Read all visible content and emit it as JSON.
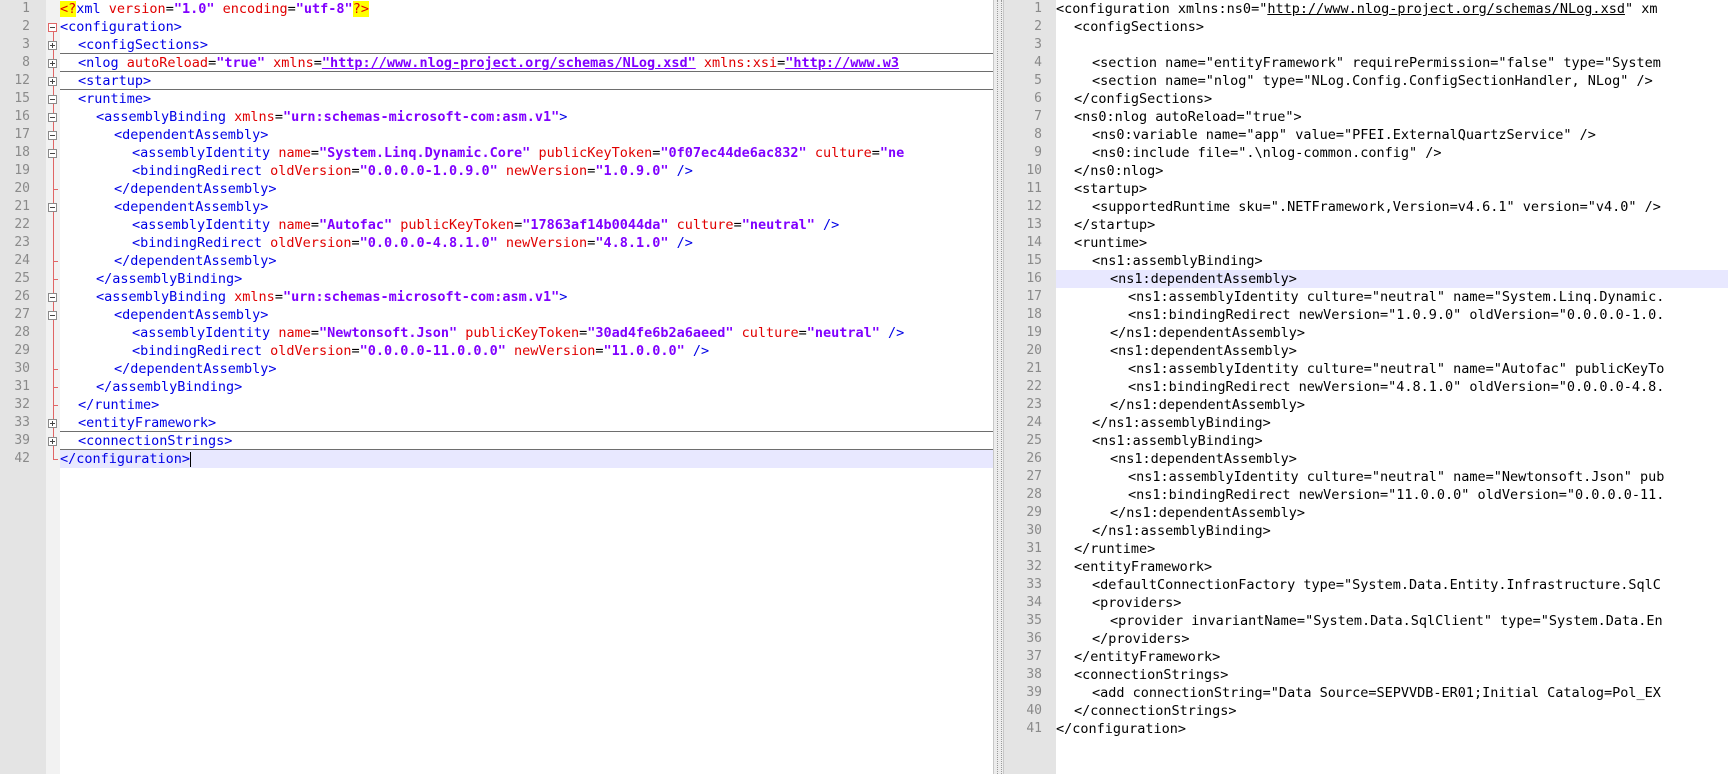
{
  "left_pane": {
    "lines": [
      {
        "num": "1",
        "indent": 0,
        "tokens": [
          {
            "k": "pi",
            "t": "<?"
          },
          {
            "k": "tag",
            "t": "xml "
          },
          {
            "k": "attr",
            "t": "version"
          },
          {
            "k": "plain",
            "t": "="
          },
          {
            "k": "val",
            "t": "\"1.0\""
          },
          {
            "k": "plain",
            "t": " "
          },
          {
            "k": "attr",
            "t": "encoding"
          },
          {
            "k": "plain",
            "t": "="
          },
          {
            "k": "val",
            "t": "\"utf-8\""
          },
          {
            "k": "pi",
            "t": "?>"
          }
        ]
      },
      {
        "num": "2",
        "indent": 0,
        "tokens": [
          {
            "k": "tag",
            "t": "<configuration>"
          }
        ]
      },
      {
        "num": "3",
        "indent": 1,
        "collapsed": true,
        "tokens": [
          {
            "k": "tag",
            "t": "<configSections>"
          }
        ]
      },
      {
        "num": "8",
        "indent": 1,
        "collapsed": true,
        "tokens": [
          {
            "k": "tag",
            "t": "<nlog "
          },
          {
            "k": "attr",
            "t": "autoReload"
          },
          {
            "k": "plain",
            "t": "="
          },
          {
            "k": "val",
            "t": "\"true\""
          },
          {
            "k": "plain",
            "t": " "
          },
          {
            "k": "attr",
            "t": "xmlns"
          },
          {
            "k": "plain",
            "t": "="
          },
          {
            "k": "url",
            "t": "\"http://www.nlog-project.org/schemas/NLog.xsd\""
          },
          {
            "k": "plain",
            "t": " "
          },
          {
            "k": "attr",
            "t": "xmlns:xsi"
          },
          {
            "k": "plain",
            "t": "="
          },
          {
            "k": "url",
            "t": "\"http://www.w3"
          }
        ]
      },
      {
        "num": "12",
        "indent": 1,
        "collapsed": true,
        "tokens": [
          {
            "k": "tag",
            "t": "<startup>"
          }
        ]
      },
      {
        "num": "15",
        "indent": 1,
        "tokens": [
          {
            "k": "tag",
            "t": "<runtime>"
          }
        ]
      },
      {
        "num": "16",
        "indent": 2,
        "tokens": [
          {
            "k": "tag",
            "t": "<assemblyBinding "
          },
          {
            "k": "attr",
            "t": "xmlns"
          },
          {
            "k": "plain",
            "t": "="
          },
          {
            "k": "val",
            "t": "\"urn:schemas-microsoft-com:asm.v1\""
          },
          {
            "k": "tag",
            "t": ">"
          }
        ]
      },
      {
        "num": "17",
        "indent": 3,
        "tokens": [
          {
            "k": "tag",
            "t": "<dependentAssembly>"
          }
        ]
      },
      {
        "num": "18",
        "indent": 4,
        "tokens": [
          {
            "k": "tag",
            "t": "<assemblyIdentity "
          },
          {
            "k": "attr",
            "t": "name"
          },
          {
            "k": "plain",
            "t": "="
          },
          {
            "k": "val",
            "t": "\"System.Linq.Dynamic.Core\""
          },
          {
            "k": "plain",
            "t": " "
          },
          {
            "k": "attr",
            "t": "publicKeyToken"
          },
          {
            "k": "plain",
            "t": "="
          },
          {
            "k": "val",
            "t": "\"0f07ec44de6ac832\""
          },
          {
            "k": "plain",
            "t": " "
          },
          {
            "k": "attr",
            "t": "culture"
          },
          {
            "k": "plain",
            "t": "="
          },
          {
            "k": "val",
            "t": "\"ne"
          }
        ]
      },
      {
        "num": "19",
        "indent": 4,
        "tokens": [
          {
            "k": "tag",
            "t": "<bindingRedirect "
          },
          {
            "k": "attr",
            "t": "oldVersion"
          },
          {
            "k": "plain",
            "t": "="
          },
          {
            "k": "val",
            "t": "\"0.0.0.0-1.0.9.0\""
          },
          {
            "k": "plain",
            "t": " "
          },
          {
            "k": "attr",
            "t": "newVersion"
          },
          {
            "k": "plain",
            "t": "="
          },
          {
            "k": "val",
            "t": "\"1.0.9.0\""
          },
          {
            "k": "plain",
            "t": " "
          },
          {
            "k": "tag",
            "t": "/>"
          }
        ]
      },
      {
        "num": "20",
        "indent": 3,
        "tokens": [
          {
            "k": "tag",
            "t": "</dependentAssembly>"
          }
        ]
      },
      {
        "num": "21",
        "indent": 3,
        "tokens": [
          {
            "k": "tag",
            "t": "<dependentAssembly>"
          }
        ]
      },
      {
        "num": "22",
        "indent": 4,
        "tokens": [
          {
            "k": "tag",
            "t": "<assemblyIdentity "
          },
          {
            "k": "attr",
            "t": "name"
          },
          {
            "k": "plain",
            "t": "="
          },
          {
            "k": "val",
            "t": "\"Autofac\""
          },
          {
            "k": "plain",
            "t": " "
          },
          {
            "k": "attr",
            "t": "publicKeyToken"
          },
          {
            "k": "plain",
            "t": "="
          },
          {
            "k": "val",
            "t": "\"17863af14b0044da\""
          },
          {
            "k": "plain",
            "t": " "
          },
          {
            "k": "attr",
            "t": "culture"
          },
          {
            "k": "plain",
            "t": "="
          },
          {
            "k": "val",
            "t": "\"neutral\""
          },
          {
            "k": "plain",
            "t": " "
          },
          {
            "k": "tag",
            "t": "/>"
          }
        ]
      },
      {
        "num": "23",
        "indent": 4,
        "tokens": [
          {
            "k": "tag",
            "t": "<bindingRedirect "
          },
          {
            "k": "attr",
            "t": "oldVersion"
          },
          {
            "k": "plain",
            "t": "="
          },
          {
            "k": "val",
            "t": "\"0.0.0.0-4.8.1.0\""
          },
          {
            "k": "plain",
            "t": " "
          },
          {
            "k": "attr",
            "t": "newVersion"
          },
          {
            "k": "plain",
            "t": "="
          },
          {
            "k": "val",
            "t": "\"4.8.1.0\""
          },
          {
            "k": "plain",
            "t": " "
          },
          {
            "k": "tag",
            "t": "/>"
          }
        ]
      },
      {
        "num": "24",
        "indent": 3,
        "tokens": [
          {
            "k": "tag",
            "t": "</dependentAssembly>"
          }
        ]
      },
      {
        "num": "25",
        "indent": 2,
        "tokens": [
          {
            "k": "tag",
            "t": "</assemblyBinding>"
          }
        ]
      },
      {
        "num": "26",
        "indent": 2,
        "tokens": [
          {
            "k": "tag",
            "t": "<assemblyBinding "
          },
          {
            "k": "attr",
            "t": "xmlns"
          },
          {
            "k": "plain",
            "t": "="
          },
          {
            "k": "val",
            "t": "\"urn:schemas-microsoft-com:asm.v1\""
          },
          {
            "k": "tag",
            "t": ">"
          }
        ]
      },
      {
        "num": "27",
        "indent": 3,
        "tokens": [
          {
            "k": "tag",
            "t": "<dependentAssembly>"
          }
        ]
      },
      {
        "num": "28",
        "indent": 4,
        "tokens": [
          {
            "k": "tag",
            "t": "<assemblyIdentity "
          },
          {
            "k": "attr",
            "t": "name"
          },
          {
            "k": "plain",
            "t": "="
          },
          {
            "k": "val",
            "t": "\"Newtonsoft.Json\""
          },
          {
            "k": "plain",
            "t": " "
          },
          {
            "k": "attr",
            "t": "publicKeyToken"
          },
          {
            "k": "plain",
            "t": "="
          },
          {
            "k": "val",
            "t": "\"30ad4fe6b2a6aeed\""
          },
          {
            "k": "plain",
            "t": " "
          },
          {
            "k": "attr",
            "t": "culture"
          },
          {
            "k": "plain",
            "t": "="
          },
          {
            "k": "val",
            "t": "\"neutral\""
          },
          {
            "k": "plain",
            "t": " "
          },
          {
            "k": "tag",
            "t": "/>"
          }
        ]
      },
      {
        "num": "29",
        "indent": 4,
        "tokens": [
          {
            "k": "tag",
            "t": "<bindingRedirect "
          },
          {
            "k": "attr",
            "t": "oldVersion"
          },
          {
            "k": "plain",
            "t": "="
          },
          {
            "k": "val",
            "t": "\"0.0.0.0-11.0.0.0\""
          },
          {
            "k": "plain",
            "t": " "
          },
          {
            "k": "attr",
            "t": "newVersion"
          },
          {
            "k": "plain",
            "t": "="
          },
          {
            "k": "val",
            "t": "\"11.0.0.0\""
          },
          {
            "k": "plain",
            "t": " "
          },
          {
            "k": "tag",
            "t": "/>"
          }
        ]
      },
      {
        "num": "30",
        "indent": 3,
        "tokens": [
          {
            "k": "tag",
            "t": "</dependentAssembly>"
          }
        ]
      },
      {
        "num": "31",
        "indent": 2,
        "tokens": [
          {
            "k": "tag",
            "t": "</assemblyBinding>"
          }
        ]
      },
      {
        "num": "32",
        "indent": 1,
        "tokens": [
          {
            "k": "tag",
            "t": "</runtime>"
          }
        ]
      },
      {
        "num": "33",
        "indent": 1,
        "collapsed": true,
        "tokens": [
          {
            "k": "tag",
            "t": "<entityFramework>"
          }
        ]
      },
      {
        "num": "39",
        "indent": 1,
        "collapsed": true,
        "tokens": [
          {
            "k": "tag",
            "t": "<connectionStrings>"
          }
        ]
      },
      {
        "num": "42",
        "indent": 0,
        "current": true,
        "caret": true,
        "tokens": [
          {
            "k": "tag",
            "t": "</configuration>"
          }
        ]
      }
    ]
  },
  "right_pane": {
    "lines": [
      {
        "num": "1",
        "indent": 0,
        "tokens": [
          {
            "k": "plain",
            "t": "<configuration xmlns:ns0=\""
          },
          {
            "k": "ulink",
            "t": "http://www.nlog-project.org/schemas/NLog.xsd"
          },
          {
            "k": "plain",
            "t": "\" xm"
          }
        ]
      },
      {
        "num": "2",
        "indent": 1,
        "tokens": [
          {
            "k": "plain",
            "t": "<configSections>"
          }
        ]
      },
      {
        "num": "3",
        "indent": 0,
        "tokens": []
      },
      {
        "num": "4",
        "indent": 2,
        "tokens": [
          {
            "k": "plain",
            "t": "<section name=\"entityFramework\" requirePermission=\"false\" type=\"System"
          }
        ]
      },
      {
        "num": "5",
        "indent": 2,
        "tokens": [
          {
            "k": "plain",
            "t": "<section name=\"nlog\" type=\"NLog.Config.ConfigSectionHandler, NLog\" />"
          }
        ]
      },
      {
        "num": "6",
        "indent": 1,
        "tokens": [
          {
            "k": "plain",
            "t": "</configSections>"
          }
        ]
      },
      {
        "num": "7",
        "indent": 1,
        "tokens": [
          {
            "k": "plain",
            "t": "<ns0:nlog autoReload=\"true\">"
          }
        ]
      },
      {
        "num": "8",
        "indent": 2,
        "tokens": [
          {
            "k": "plain",
            "t": "<ns0:variable name=\"app\" value=\"PFEI.ExternalQuartzService\" />"
          }
        ]
      },
      {
        "num": "9",
        "indent": 2,
        "tokens": [
          {
            "k": "plain",
            "t": "<ns0:include file=\".\\nlog-common.config\" />"
          }
        ]
      },
      {
        "num": "10",
        "indent": 1,
        "tokens": [
          {
            "k": "plain",
            "t": "</ns0:nlog>"
          }
        ]
      },
      {
        "num": "11",
        "indent": 1,
        "tokens": [
          {
            "k": "plain",
            "t": "<startup>"
          }
        ]
      },
      {
        "num": "12",
        "indent": 2,
        "tokens": [
          {
            "k": "plain",
            "t": "<supportedRuntime sku=\".NETFramework,Version=v4.6.1\" version=\"v4.0\" />"
          }
        ]
      },
      {
        "num": "13",
        "indent": 1,
        "tokens": [
          {
            "k": "plain",
            "t": "</startup>"
          }
        ]
      },
      {
        "num": "14",
        "indent": 1,
        "tokens": [
          {
            "k": "plain",
            "t": "<runtime>"
          }
        ]
      },
      {
        "num": "15",
        "indent": 2,
        "tokens": [
          {
            "k": "plain",
            "t": "<ns1:assemblyBinding>"
          }
        ]
      },
      {
        "num": "16",
        "indent": 3,
        "current": true,
        "tokens": [
          {
            "k": "plain",
            "t": "<ns1:dependentAssembly>"
          }
        ]
      },
      {
        "num": "17",
        "indent": 4,
        "tokens": [
          {
            "k": "plain",
            "t": "<ns1:assemblyIdentity culture=\"neutral\" name=\"System.Linq.Dynamic."
          }
        ]
      },
      {
        "num": "18",
        "indent": 4,
        "tokens": [
          {
            "k": "plain",
            "t": "<ns1:bindingRedirect newVersion=\"1.0.9.0\" oldVersion=\"0.0.0.0-1.0."
          }
        ]
      },
      {
        "num": "19",
        "indent": 3,
        "tokens": [
          {
            "k": "plain",
            "t": "</ns1:dependentAssembly>"
          }
        ]
      },
      {
        "num": "20",
        "indent": 3,
        "tokens": [
          {
            "k": "plain",
            "t": "<ns1:dependentAssembly>"
          }
        ]
      },
      {
        "num": "21",
        "indent": 4,
        "tokens": [
          {
            "k": "plain",
            "t": "<ns1:assemblyIdentity culture=\"neutral\" name=\"Autofac\" publicKeyTo"
          }
        ]
      },
      {
        "num": "22",
        "indent": 4,
        "tokens": [
          {
            "k": "plain",
            "t": "<ns1:bindingRedirect newVersion=\"4.8.1.0\" oldVersion=\"0.0.0.0-4.8."
          }
        ]
      },
      {
        "num": "23",
        "indent": 3,
        "tokens": [
          {
            "k": "plain",
            "t": "</ns1:dependentAssembly>"
          }
        ]
      },
      {
        "num": "24",
        "indent": 2,
        "tokens": [
          {
            "k": "plain",
            "t": "</ns1:assemblyBinding>"
          }
        ]
      },
      {
        "num": "25",
        "indent": 2,
        "tokens": [
          {
            "k": "plain",
            "t": "<ns1:assemblyBinding>"
          }
        ]
      },
      {
        "num": "26",
        "indent": 3,
        "tokens": [
          {
            "k": "plain",
            "t": "<ns1:dependentAssembly>"
          }
        ]
      },
      {
        "num": "27",
        "indent": 4,
        "tokens": [
          {
            "k": "plain",
            "t": "<ns1:assemblyIdentity culture=\"neutral\" name=\"Newtonsoft.Json\" pub"
          }
        ]
      },
      {
        "num": "28",
        "indent": 4,
        "tokens": [
          {
            "k": "plain",
            "t": "<ns1:bindingRedirect newVersion=\"11.0.0.0\" oldVersion=\"0.0.0.0-11."
          }
        ]
      },
      {
        "num": "29",
        "indent": 3,
        "tokens": [
          {
            "k": "plain",
            "t": "</ns1:dependentAssembly>"
          }
        ]
      },
      {
        "num": "30",
        "indent": 2,
        "tokens": [
          {
            "k": "plain",
            "t": "</ns1:assemblyBinding>"
          }
        ]
      },
      {
        "num": "31",
        "indent": 1,
        "tokens": [
          {
            "k": "plain",
            "t": "</runtime>"
          }
        ]
      },
      {
        "num": "32",
        "indent": 1,
        "tokens": [
          {
            "k": "plain",
            "t": "<entityFramework>"
          }
        ]
      },
      {
        "num": "33",
        "indent": 2,
        "tokens": [
          {
            "k": "plain",
            "t": "<defaultConnectionFactory type=\"System.Data.Entity.Infrastructure.SqlC"
          }
        ]
      },
      {
        "num": "34",
        "indent": 2,
        "tokens": [
          {
            "k": "plain",
            "t": "<providers>"
          }
        ]
      },
      {
        "num": "35",
        "indent": 3,
        "tokens": [
          {
            "k": "plain",
            "t": "<provider invariantName=\"System.Data.SqlClient\" type=\"System.Data.En"
          }
        ]
      },
      {
        "num": "36",
        "indent": 2,
        "tokens": [
          {
            "k": "plain",
            "t": "</providers>"
          }
        ]
      },
      {
        "num": "37",
        "indent": 1,
        "tokens": [
          {
            "k": "plain",
            "t": "</entityFramework>"
          }
        ]
      },
      {
        "num": "38",
        "indent": 1,
        "tokens": [
          {
            "k": "plain",
            "t": "<connectionStrings>"
          }
        ]
      },
      {
        "num": "39",
        "indent": 2,
        "tokens": [
          {
            "k": "plain",
            "t": "<add connectionString=\"Data Source=SEPVVDB-ER01;Initial Catalog=Pol_EX"
          }
        ]
      },
      {
        "num": "40",
        "indent": 1,
        "tokens": [
          {
            "k": "plain",
            "t": "</connectionStrings>"
          }
        ]
      },
      {
        "num": "41",
        "indent": 0,
        "tokens": [
          {
            "k": "plain",
            "t": "</configuration>"
          }
        ]
      }
    ]
  }
}
